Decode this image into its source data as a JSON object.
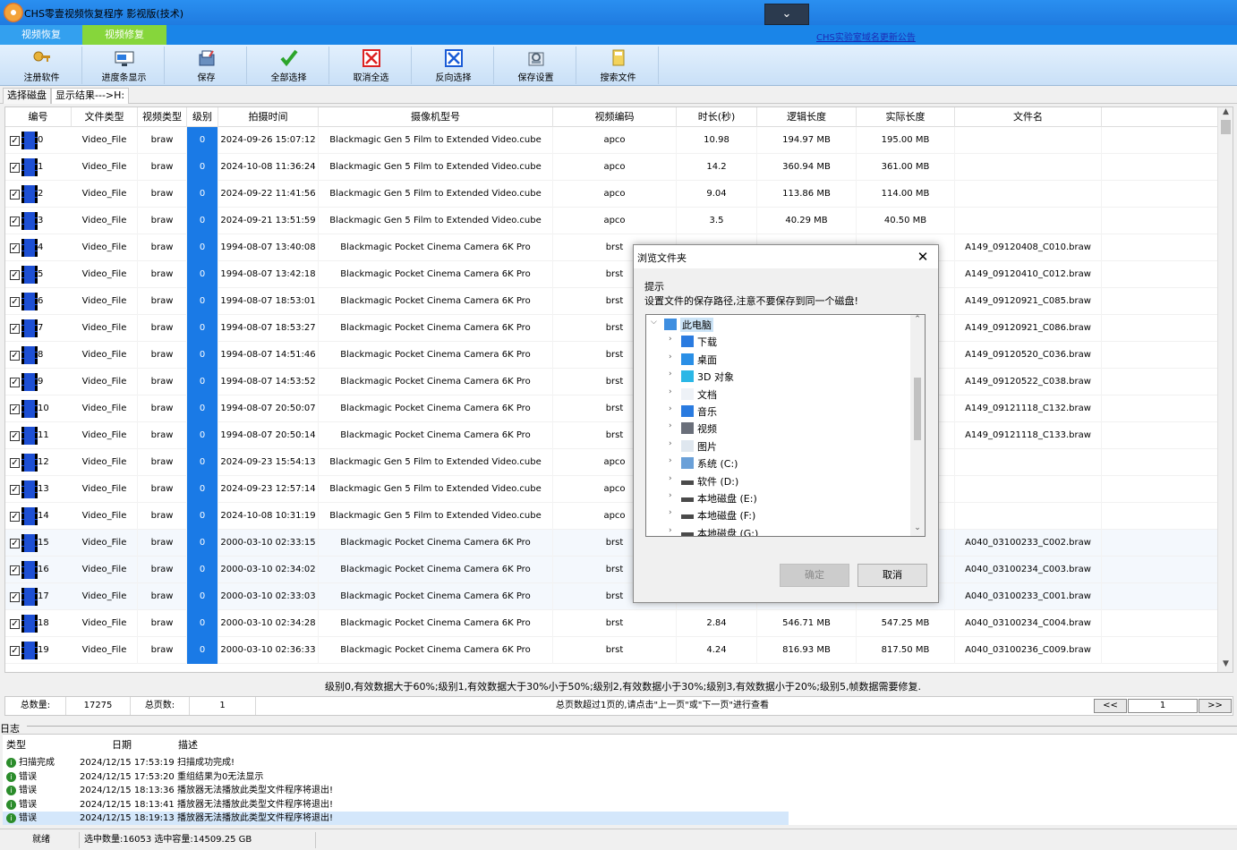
{
  "app": {
    "title": "CHS零壹视频恢复程序 影视版(技术)",
    "modes": [
      "视频恢复",
      "视频修复"
    ],
    "announcement": "CHS实验室域名更新公告"
  },
  "toolbar": [
    {
      "label": "注册软件",
      "icon": "key-icon"
    },
    {
      "label": "进度条显示",
      "icon": "progress-icon"
    },
    {
      "label": "保存",
      "icon": "save-icon"
    },
    {
      "label": "全部选择",
      "icon": "check-icon"
    },
    {
      "label": "取消全选",
      "icon": "red-x-icon"
    },
    {
      "label": "反向选择",
      "icon": "blue-x-icon"
    },
    {
      "label": "保存设置",
      "icon": "settings-icon"
    },
    {
      "label": "搜索文件",
      "icon": "search-file-icon"
    }
  ],
  "scan_tabs": [
    "选择磁盘",
    "显示结果--->H:"
  ],
  "table": {
    "columns": [
      "编号",
      "文件类型",
      "视频类型",
      "级别",
      "拍摄时间",
      "摄像机型号",
      "视频编码",
      "时长(秒)",
      "逻辑长度",
      "实际长度",
      "文件名"
    ],
    "rows": [
      [
        "0",
        "Video_File",
        "braw",
        "0",
        "2024-09-26 15:07:12",
        "Blackmagic Gen 5 Film to Extended Video.cube",
        "apco",
        "10.98",
        "194.97 MB",
        "195.00 MB",
        ""
      ],
      [
        "1",
        "Video_File",
        "braw",
        "0",
        "2024-10-08 11:36:24",
        "Blackmagic Gen 5 Film to Extended Video.cube",
        "apco",
        "14.2",
        "360.94 MB",
        "361.00 MB",
        ""
      ],
      [
        "2",
        "Video_File",
        "braw",
        "0",
        "2024-09-22 11:41:56",
        "Blackmagic Gen 5 Film to Extended Video.cube",
        "apco",
        "9.04",
        "113.86 MB",
        "114.00 MB",
        ""
      ],
      [
        "3",
        "Video_File",
        "braw",
        "0",
        "2024-09-21 13:51:59",
        "Blackmagic Gen 5 Film to Extended Video.cube",
        "apco",
        "3.5",
        "40.29 MB",
        "40.50 MB",
        ""
      ],
      [
        "4",
        "Video_File",
        "braw",
        "0",
        "1994-08-07 13:40:08",
        "Blackmagic Pocket Cinema Camera 6K Pro",
        "brst",
        "",
        "",
        "",
        "A149_09120408_C010.braw"
      ],
      [
        "5",
        "Video_File",
        "braw",
        "0",
        "1994-08-07 13:42:18",
        "Blackmagic Pocket Cinema Camera 6K Pro",
        "brst",
        "",
        "",
        "",
        "A149_09120410_C012.braw"
      ],
      [
        "6",
        "Video_File",
        "braw",
        "0",
        "1994-08-07 18:53:01",
        "Blackmagic Pocket Cinema Camera 6K Pro",
        "brst",
        "",
        "",
        "",
        "A149_09120921_C085.braw"
      ],
      [
        "7",
        "Video_File",
        "braw",
        "0",
        "1994-08-07 18:53:27",
        "Blackmagic Pocket Cinema Camera 6K Pro",
        "brst",
        "",
        "",
        "",
        "A149_09120921_C086.braw"
      ],
      [
        "8",
        "Video_File",
        "braw",
        "0",
        "1994-08-07 14:51:46",
        "Blackmagic Pocket Cinema Camera 6K Pro",
        "brst",
        "",
        "",
        "",
        "A149_09120520_C036.braw"
      ],
      [
        "9",
        "Video_File",
        "braw",
        "0",
        "1994-08-07 14:53:52",
        "Blackmagic Pocket Cinema Camera 6K Pro",
        "brst",
        "",
        "",
        "",
        "A149_09120522_C038.braw"
      ],
      [
        "10",
        "Video_File",
        "braw",
        "0",
        "1994-08-07 20:50:07",
        "Blackmagic Pocket Cinema Camera 6K Pro",
        "brst",
        "",
        "",
        "",
        "A149_09121118_C132.braw"
      ],
      [
        "11",
        "Video_File",
        "braw",
        "0",
        "1994-08-07 20:50:14",
        "Blackmagic Pocket Cinema Camera 6K Pro",
        "brst",
        "",
        "",
        "",
        "A149_09121118_C133.braw"
      ],
      [
        "12",
        "Video_File",
        "braw",
        "0",
        "2024-09-23 15:54:13",
        "Blackmagic Gen 5 Film to Extended Video.cube",
        "apco",
        "",
        "",
        "",
        ""
      ],
      [
        "13",
        "Video_File",
        "braw",
        "0",
        "2024-09-23 12:57:14",
        "Blackmagic Gen 5 Film to Extended Video.cube",
        "apco",
        "",
        "",
        "",
        ""
      ],
      [
        "14",
        "Video_File",
        "braw",
        "0",
        "2024-10-08 10:31:19",
        "Blackmagic Gen 5 Film to Extended Video.cube",
        "apco",
        "",
        "",
        "",
        ""
      ],
      [
        "15",
        "Video_File",
        "braw",
        "0",
        "2000-03-10 02:33:15",
        "Blackmagic Pocket Cinema Camera 6K Pro",
        "brst",
        "",
        "",
        "",
        "A040_03100233_C002.braw"
      ],
      [
        "16",
        "Video_File",
        "braw",
        "0",
        "2000-03-10 02:34:02",
        "Blackmagic Pocket Cinema Camera 6K Pro",
        "brst",
        "",
        "",
        "",
        "A040_03100234_C003.braw"
      ],
      [
        "17",
        "Video_File",
        "braw",
        "0",
        "2000-03-10 02:33:03",
        "Blackmagic Pocket Cinema Camera 6K Pro",
        "brst",
        "",
        "",
        "",
        "A040_03100233_C001.braw"
      ],
      [
        "18",
        "Video_File",
        "braw",
        "0",
        "2000-03-10 02:34:28",
        "Blackmagic Pocket Cinema Camera 6K Pro",
        "brst",
        "2.84",
        "546.71 MB",
        "547.25 MB",
        "A040_03100234_C004.braw"
      ],
      [
        "19",
        "Video_File",
        "braw",
        "0",
        "2000-03-10 02:36:33",
        "Blackmagic Pocket Cinema Camera 6K Pro",
        "brst",
        "4.24",
        "816.93 MB",
        "817.50 MB",
        "A040_03100236_C009.braw"
      ]
    ]
  },
  "level_note": "级别0,有效数据大于60%;级别1,有效数据大于30%小于50%;级别2,有效数据小于30%;级别3,有效数据小于20%;级别5,帧数据需要修复.",
  "pager": {
    "total_label": "总数量:",
    "total": "17275",
    "pages_label": "总页数:",
    "pages": "1",
    "hint": "总页数超过1页的,请点击\"上一页\"或\"下一页\"进行查看",
    "prev": "<<",
    "page_input": "1",
    "next": ">>"
  },
  "log": {
    "label": "日志",
    "columns": [
      "类型",
      "日期",
      "描述"
    ],
    "entries": [
      {
        "type": "扫描完成",
        "date": "2024/12/15 17:53:19",
        "desc": "扫描成功完成!"
      },
      {
        "type": "错误",
        "date": "2024/12/15 17:53:20",
        "desc": "重组结果为0无法显示"
      },
      {
        "type": "错误",
        "date": "2024/12/15 18:13:36",
        "desc": "播放器无法播放此类型文件程序将退出!"
      },
      {
        "type": "错误",
        "date": "2024/12/15 18:13:41",
        "desc": "播放器无法播放此类型文件程序将退出!"
      },
      {
        "type": "错误",
        "date": "2024/12/15 18:19:13",
        "desc": "播放器无法播放此类型文件程序将退出!"
      }
    ]
  },
  "status": {
    "ready": "就绪",
    "selection": "选中数量:16053 选中容量:14509.25 GB"
  },
  "dialog": {
    "title": "浏览文件夹",
    "hint": "提示",
    "message": "设置文件的保存路径,注意不要保存到同一个磁盘!",
    "tree": [
      {
        "label": "此电脑",
        "icon": "computer-icon",
        "expanded": true
      },
      {
        "label": "下载",
        "icon": "download-icon"
      },
      {
        "label": "桌面",
        "icon": "desktop-icon"
      },
      {
        "label": "3D 对象",
        "icon": "cube-icon"
      },
      {
        "label": "文档",
        "icon": "document-icon"
      },
      {
        "label": "音乐",
        "icon": "music-icon"
      },
      {
        "label": "视频",
        "icon": "video-icon"
      },
      {
        "label": "图片",
        "icon": "picture-icon"
      },
      {
        "label": "系统 (C:)",
        "icon": "system-drive-icon"
      },
      {
        "label": "软件 (D:)",
        "icon": "drive-icon"
      },
      {
        "label": "本地磁盘 (E:)",
        "icon": "drive-icon"
      },
      {
        "label": "本地磁盘 (F:)",
        "icon": "drive-icon"
      },
      {
        "label": "本地磁盘 (G:)",
        "icon": "drive-icon"
      }
    ],
    "ok": "确定",
    "cancel": "取消"
  }
}
